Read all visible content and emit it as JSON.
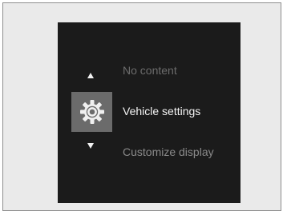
{
  "menu": {
    "previous_item": "No content",
    "current_item": "Vehicle settings",
    "next_item": "Customize display",
    "current_icon": "gear-icon",
    "up_icon": "triangle-up-icon",
    "down_icon": "triangle-down-icon"
  },
  "colors": {
    "screen_background": "#1b1b1b",
    "highlight_background": "#6b6b6b",
    "text_active": "#f4f4f4",
    "text_inactive": "#8a8a8a"
  }
}
